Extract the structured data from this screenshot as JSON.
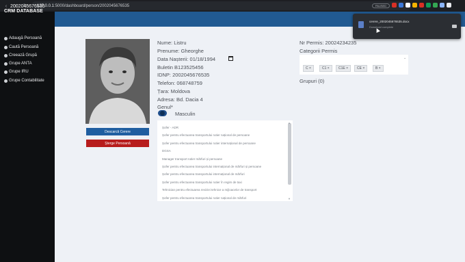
{
  "browser": {
    "url_host": "127.0.0.1",
    "url_path": ":5000/dashboard/person/2002045676535",
    "profile_label": "PAUSED",
    "ext_colors": [
      "#d93025",
      "#3c78d8",
      "#ffffff",
      "#f4b400",
      "#d93025",
      "#0f9d58",
      "#34a853",
      "#8ab4f8",
      "#e8eaed"
    ]
  },
  "sidebar": {
    "brand": "CRM DATABASE",
    "items": [
      {
        "label": "Adaugă Persoană",
        "icon": "user-plus-icon"
      },
      {
        "label": "Caută Persoană",
        "icon": "user-search-icon"
      },
      {
        "label": "Creează Grupă",
        "icon": "group-plus-icon"
      },
      {
        "label": "Grupe ANTA",
        "icon": "group-icon"
      },
      {
        "label": "Grupe IRU",
        "icon": "group-icon"
      },
      {
        "label": "Grupe Contabilitate",
        "icon": "group-icon"
      }
    ]
  },
  "header": {
    "title": "2002045676535"
  },
  "person": {
    "nume_label": "Nume:",
    "nume": "Listru",
    "prenume_label": "Prenume:",
    "prenume": "Gheorghe",
    "data_label": "Data Nașterii:",
    "data": "01/18/1994",
    "buletin_label": "Buletin",
    "buletin": "B123525456",
    "idnp_label": "IDNP:",
    "idnp": "2002045676535",
    "telefon_label": "Telefon:",
    "telefon": "068748759",
    "tara_label": "Țara:",
    "tara": "Moldova",
    "adresa_label": "Adresa:",
    "adresa": "Bd. Dacia 4",
    "gen_label": "Genul*",
    "gen": "Masculin"
  },
  "buttons": {
    "download": "Descarcă Cerere",
    "delete": "Șterge Persoană"
  },
  "courses": [
    "Șofer - ADR",
    "Șofer pentru efectuarea transportului rutier național de persoane",
    "Șofer pentru efectuarea transportului rutier internațional de persoane",
    "DGSA",
    "Manager transport rutier mărfuri și persoane",
    "Șofer pentru efectuarea transportului internațional de mărfuri și persoane",
    "Șofer pentru efectuarea transportului internațional de mărfuri",
    "Șofer pentru efectuarea transportului rutier în regim de taxi",
    "Tehnician pentru efectuarea reviziei tehnice a mijloacelor de transport",
    "Șofer pentru efectuarea transportului rutier național de mărfuri"
  ],
  "permis": {
    "nr_label": "Nr Permis:",
    "nr": "20024234235",
    "categorii_label": "Categorii Permis",
    "categorii": [
      "C ×",
      "C1 ×",
      "C1E ×",
      "CE ×",
      "B ×"
    ],
    "grupuri_label": "Grupuri (0)"
  },
  "download": {
    "filename": "cerere_2002045676535.docx",
    "status": "Download complete"
  }
}
